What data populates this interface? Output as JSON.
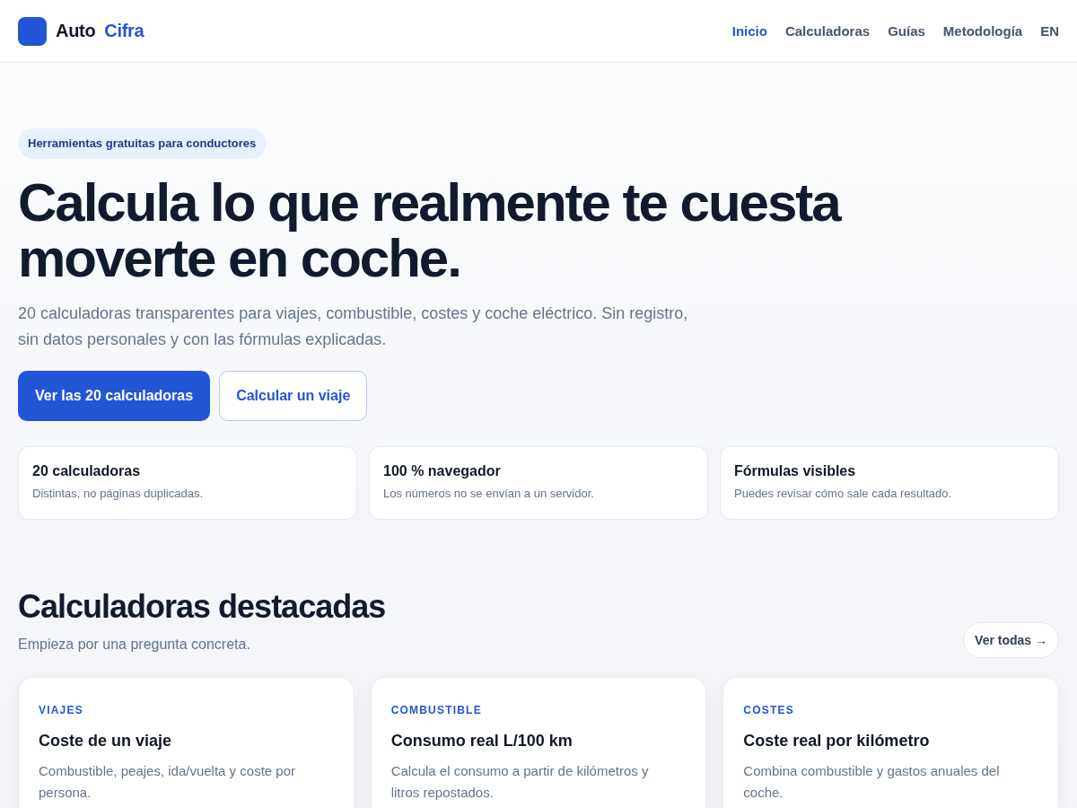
{
  "header": {
    "logo": {
      "name": "Auto",
      "accent": "Cifra"
    },
    "nav": [
      {
        "label": "Inicio",
        "selected": true
      },
      {
        "label": "Calculadoras",
        "selected": false
      },
      {
        "label": "Guías",
        "selected": false
      },
      {
        "label": "Metodología",
        "selected": false
      },
      {
        "label": "EN",
        "selected": false
      }
    ]
  },
  "hero": {
    "badge": "Herramientas gratuitas para conductores",
    "title": "Calcula lo que realmente te cuesta moverte en coche.",
    "lead": "20 calculadoras transparentes para viajes, combustible, costes y coche eléctrico. Sin registro, sin datos personales y con las fórmulas explicadas.",
    "buttons": [
      {
        "label": "Ver las 20 calculadoras",
        "kind": "primary"
      },
      {
        "label": "Calcular un viaje",
        "kind": "secondary"
      }
    ],
    "highlights": [
      {
        "title": "20 calculadoras",
        "text": "Distintas, no páginas duplicadas."
      },
      {
        "title": "100 % navegador",
        "text": "Los números no se envían a un servidor."
      },
      {
        "title": "Fórmulas visibles",
        "text": "Puedes revisar cómo sale cada resultado."
      }
    ]
  },
  "featured": {
    "title": "Calculadoras destacadas",
    "subtitle": "Empieza por una pregunta concreta.",
    "view_all": "Ver todas →",
    "cards": [
      {
        "category": "VIAJES",
        "title": "Coste de un viaje",
        "description": "Combustible, peajes, ida/vuelta y coste por persona."
      },
      {
        "category": "COMBUSTIBLE",
        "title": "Consumo real L/100 km",
        "description": "Calcula el consumo a partir de kilómetros y litros repostados."
      },
      {
        "category": "COSTES",
        "title": "Coste real por kilómetro",
        "description": "Combina combustible y gastos anuales del coche."
      }
    ]
  }
}
